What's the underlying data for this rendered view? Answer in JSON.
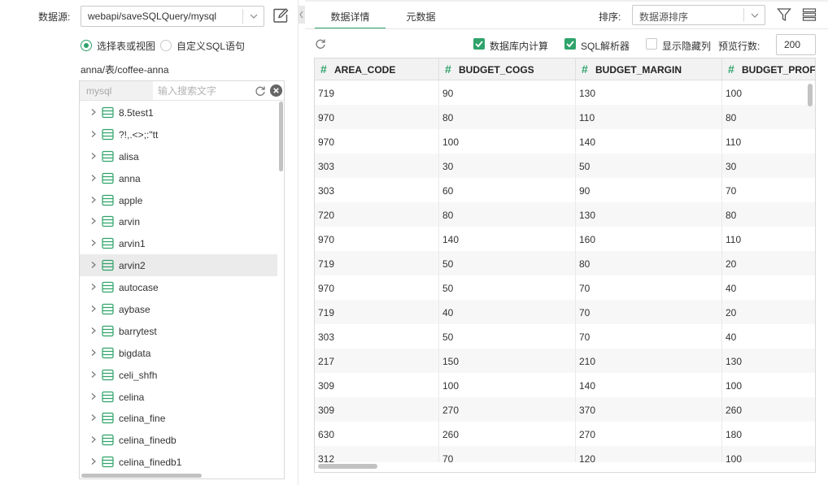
{
  "datasource": {
    "label": "数据源:",
    "value": "webapi/saveSQLQuery/mysql"
  },
  "mode": {
    "table_view": "选择表或视图",
    "custom_sql": "自定义SQL语句",
    "selected": "table_view"
  },
  "path": "anna/表/coffee-anna",
  "search": {
    "db": "mysql",
    "placeholder": "输入搜索文字"
  },
  "tree": {
    "selected": "arvin2",
    "items": [
      "8.5test1",
      "?!,.<>;:\"tt",
      "alisa",
      "anna",
      "apple",
      "arvin",
      "arvin1",
      "arvin2",
      "autocase",
      "aybase",
      "barrytest",
      "bigdata",
      "celi_shfh",
      "celina",
      "celina_fine",
      "celina_finedb",
      "celina_finedb1"
    ]
  },
  "tabs": {
    "details": "数据详情",
    "metadata": "元数据",
    "active": "details"
  },
  "sort": {
    "label": "排序:",
    "value": "数据源排序"
  },
  "options": {
    "db_compute": "数据库内计算",
    "sql_parser": "SQL解析器",
    "show_hidden": "显示隐藏列",
    "preview_rows_label": "预览行数:",
    "preview_rows": "200",
    "db_compute_checked": true,
    "sql_parser_checked": true,
    "show_hidden_checked": false
  },
  "table": {
    "column_icon": "#",
    "columns": [
      "AREA_CODE",
      "BUDGET_COGS",
      "BUDGET_MARGIN",
      "BUDGET_PROFIT"
    ],
    "rows": [
      [
        "719",
        "90",
        "130",
        "100"
      ],
      [
        "970",
        "80",
        "110",
        "80"
      ],
      [
        "970",
        "100",
        "140",
        "110"
      ],
      [
        "303",
        "30",
        "50",
        "30"
      ],
      [
        "303",
        "60",
        "90",
        "70"
      ],
      [
        "720",
        "80",
        "130",
        "80"
      ],
      [
        "970",
        "140",
        "160",
        "110"
      ],
      [
        "719",
        "50",
        "80",
        "20"
      ],
      [
        "970",
        "50",
        "70",
        "40"
      ],
      [
        "719",
        "40",
        "70",
        "20"
      ],
      [
        "303",
        "50",
        "70",
        "40"
      ],
      [
        "217",
        "150",
        "210",
        "130"
      ],
      [
        "309",
        "100",
        "140",
        "100"
      ],
      [
        "309",
        "270",
        "370",
        "260"
      ],
      [
        "630",
        "260",
        "270",
        "180"
      ],
      [
        "312",
        "70",
        "120",
        "100"
      ]
    ]
  },
  "colors": {
    "accent": "#2fa36b",
    "selected_row": "#ebebeb",
    "alt_row": "#f7f7f7"
  }
}
